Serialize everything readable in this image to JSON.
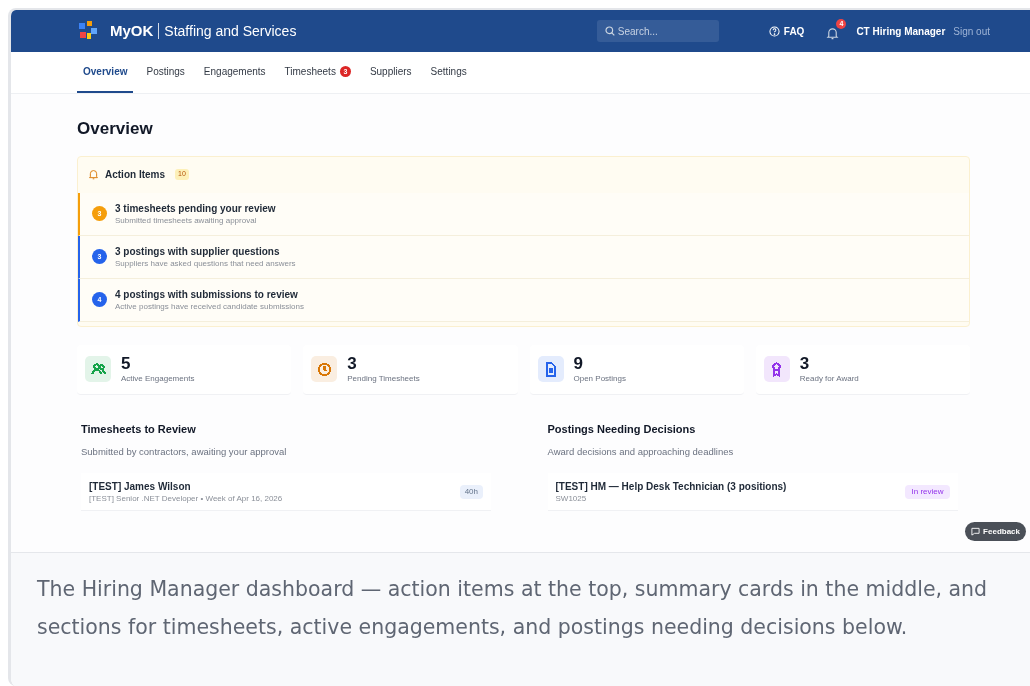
{
  "header": {
    "brand": "MyOK",
    "app_title": "Staffing and Services",
    "search": {
      "placeholder": "Search..."
    },
    "faq": "FAQ",
    "notifications_count": "4",
    "user": "CT Hiring Manager",
    "sign_out": "Sign out"
  },
  "tabs": [
    {
      "label": "Overview",
      "selected": true
    },
    {
      "label": "Postings",
      "selected": false
    },
    {
      "label": "Engagements",
      "selected": false
    },
    {
      "label": "Timesheets",
      "selected": false,
      "badge": "3"
    },
    {
      "label": "Suppliers",
      "selected": false
    },
    {
      "label": "Settings",
      "selected": false
    }
  ],
  "page_title": "Overview",
  "action_items": {
    "title": "Action Items",
    "count": "10",
    "items": [
      {
        "count": "3",
        "title": "3 timesheets pending your review",
        "subtitle": "Submitted timesheets awaiting approval",
        "color": "#f59e0b"
      },
      {
        "count": "3",
        "title": "3 postings with supplier questions",
        "subtitle": "Suppliers have asked questions that need answers",
        "color": "#2563eb"
      },
      {
        "count": "4",
        "title": "4 postings with submissions to review",
        "subtitle": "Active postings have received candidate submissions",
        "color": "#2563eb"
      }
    ]
  },
  "stats": [
    {
      "kind": "people",
      "value": "5",
      "label": "Active Engagements",
      "color": "#16a34a"
    },
    {
      "kind": "clock",
      "value": "3",
      "label": "Pending Timesheets",
      "color": "#d97706"
    },
    {
      "kind": "document",
      "value": "9",
      "label": "Open Postings",
      "color": "#2563eb"
    },
    {
      "kind": "award",
      "value": "3",
      "label": "Ready for Award",
      "color": "#9333ea"
    }
  ],
  "sections": [
    {
      "title": "Timesheets to Review",
      "subtitle": "Submitted by contractors, awaiting your approval",
      "items": [
        {
          "title": "[TEST] James Wilson",
          "subtitle": "[TEST] Senior .NET Developer • Week of Apr 16, 2026",
          "badge": "40h",
          "kind": "hours"
        }
      ]
    },
    {
      "title": "Postings Needing Decisions",
      "subtitle": "Award decisions and approaching deadlines",
      "items": [
        {
          "title": "[TEST] HM — Help Desk Technician (3 positions)",
          "subtitle": "SW1025",
          "badge": "In review",
          "kind": "status"
        }
      ]
    }
  ],
  "feedback_button": "Feedback",
  "caption": "The Hiring Manager dashboard — action items at the top, summary cards in the middle, and sections for timesheets, active engagements, and postings needing decisions below."
}
